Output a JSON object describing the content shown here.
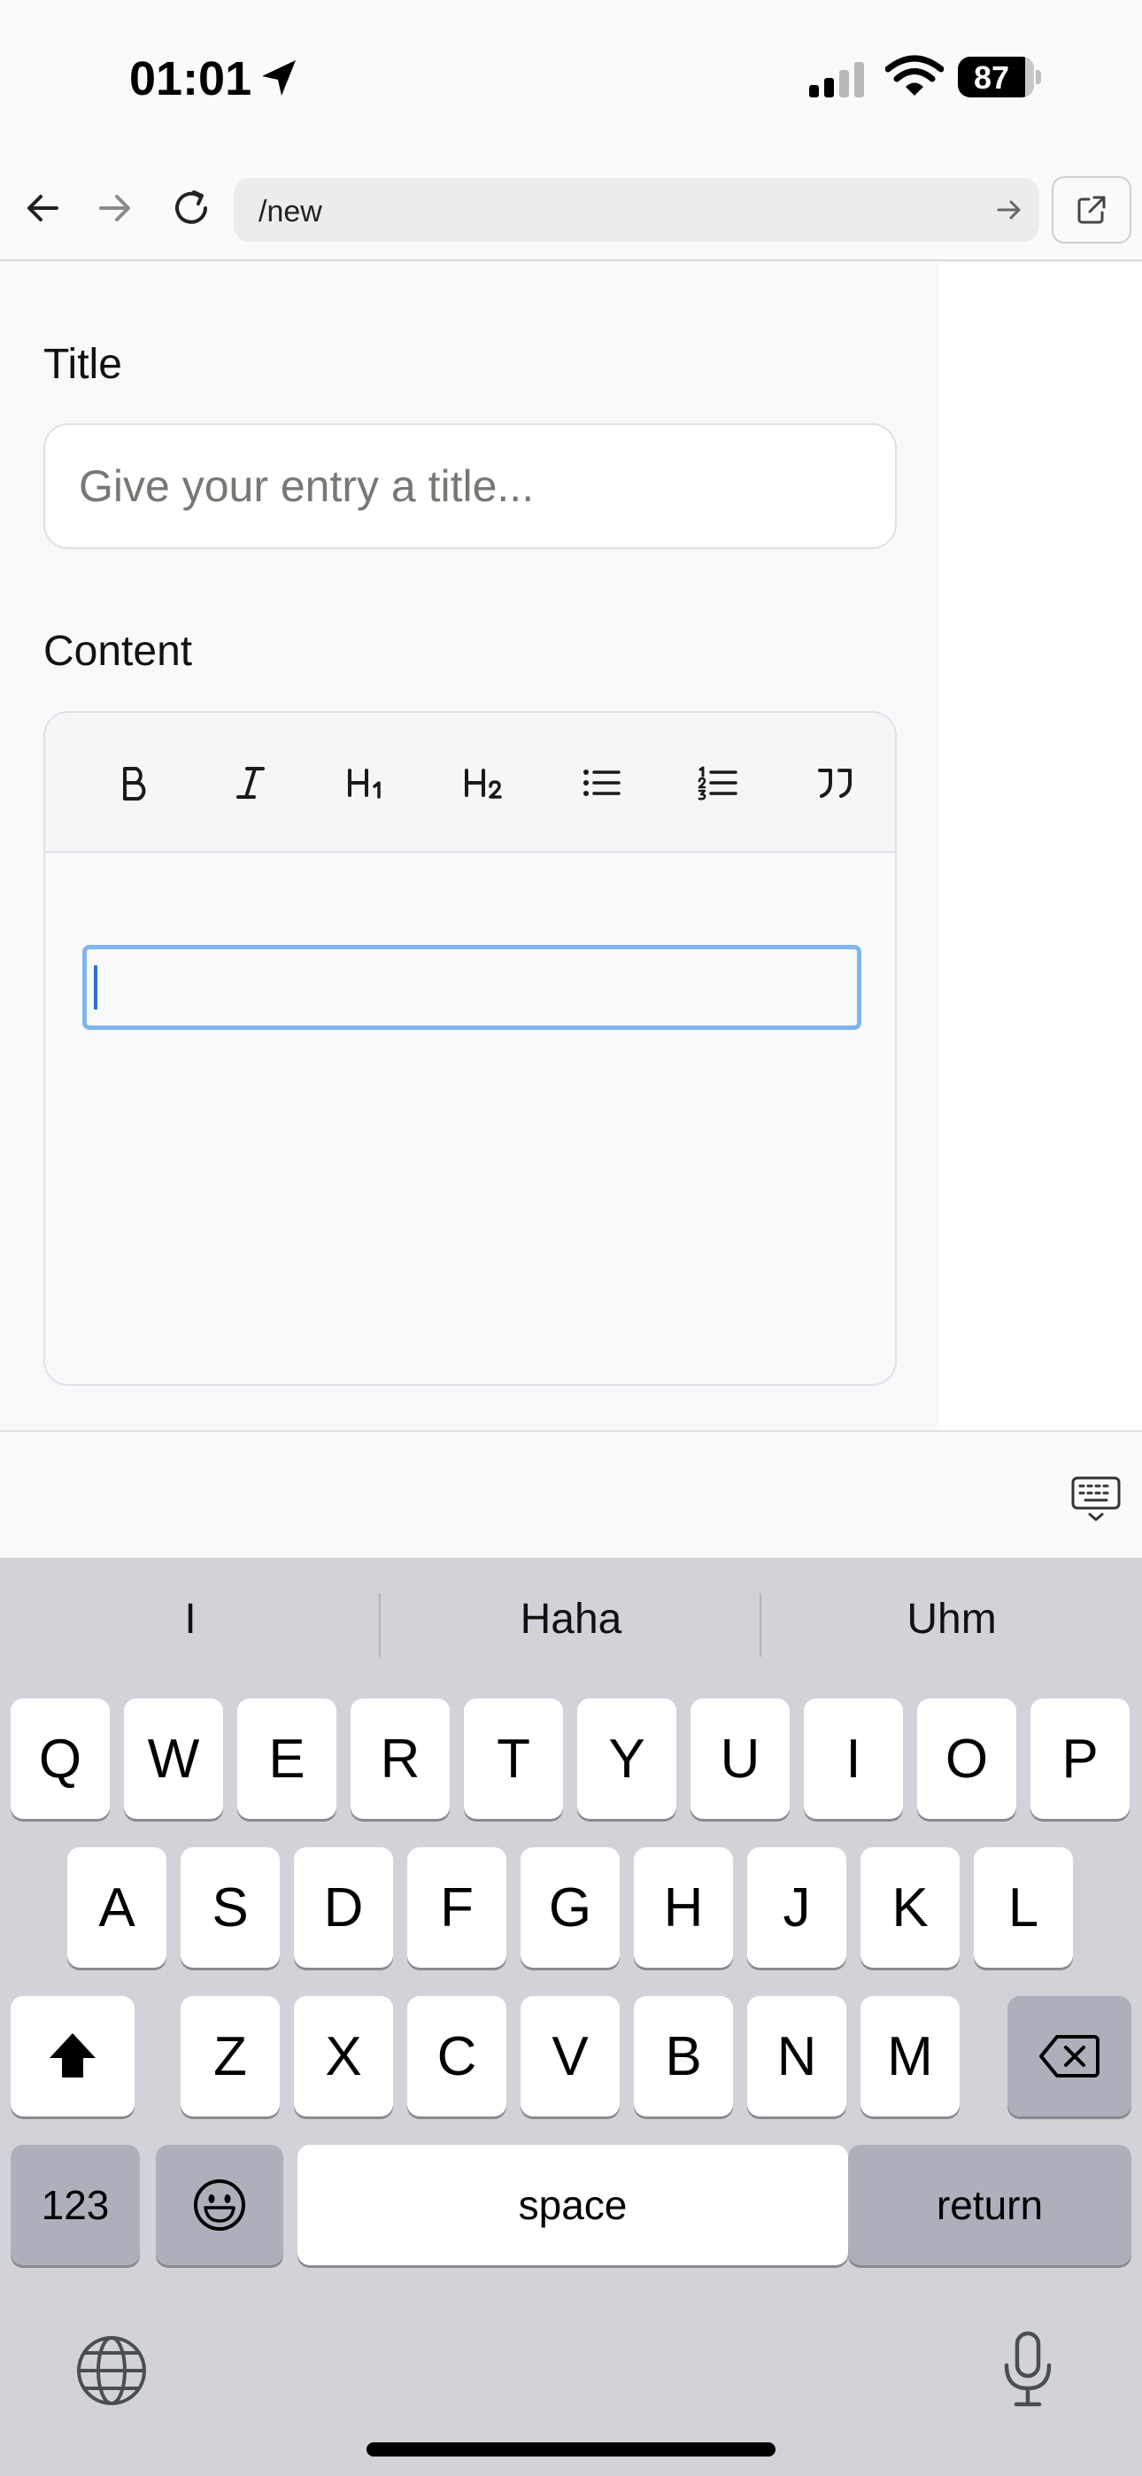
{
  "status_bar": {
    "time": "01:01",
    "battery_percent": "87"
  },
  "browser": {
    "url": "/new"
  },
  "form": {
    "title_label": "Title",
    "title_placeholder": "Give your entry a title...",
    "title_value": "",
    "content_label": "Content",
    "content_value": ""
  },
  "toolbar": {
    "buttons": [
      {
        "name": "bold",
        "glyph": "B"
      },
      {
        "name": "italic",
        "glyph": "I"
      },
      {
        "name": "heading-1",
        "glyph": "H1"
      },
      {
        "name": "heading-2",
        "glyph": "H2"
      },
      {
        "name": "bullet-list",
        "glyph": "bullet-list-icon"
      },
      {
        "name": "numbered-list",
        "glyph": "numbered-list-icon"
      },
      {
        "name": "quote",
        "glyph": "quote-icon"
      }
    ]
  },
  "keyboard": {
    "suggestions": [
      "I",
      "Haha",
      "Uhm"
    ],
    "row1": [
      "Q",
      "W",
      "E",
      "R",
      "T",
      "Y",
      "U",
      "I",
      "O",
      "P"
    ],
    "row2": [
      "A",
      "S",
      "D",
      "F",
      "G",
      "H",
      "J",
      "K",
      "L"
    ],
    "row3": [
      "Z",
      "X",
      "C",
      "V",
      "B",
      "N",
      "M"
    ],
    "numbers_label": "123",
    "space_label": "space",
    "return_label": "return"
  },
  "colors": {
    "focus_ring": "#80b4ee",
    "caret": "#2b6fd8",
    "keyboard_bg": "#d1d3d9"
  }
}
